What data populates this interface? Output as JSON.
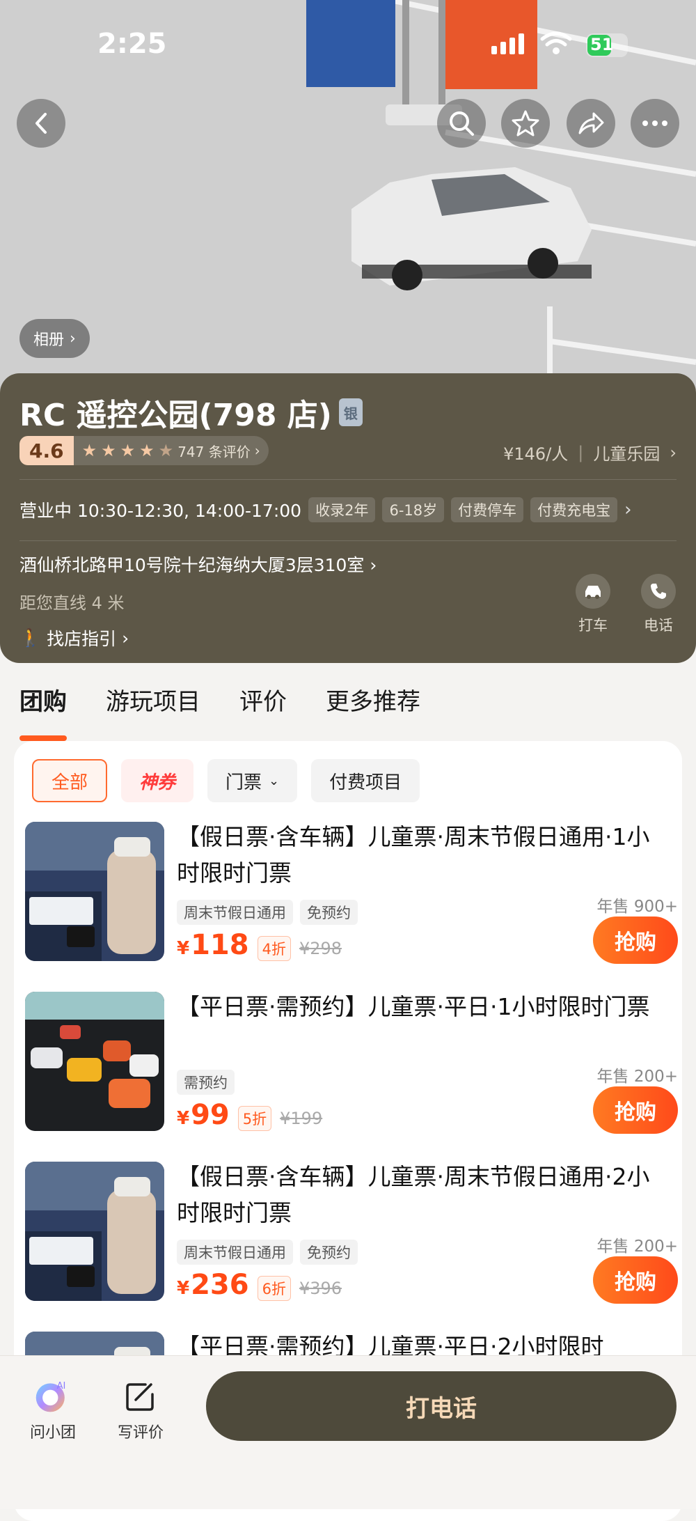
{
  "status": {
    "time": "2:25",
    "battery": "51"
  },
  "hero": {
    "album_label": "相册"
  },
  "shop": {
    "name": "RC 遥控公园(798 店)",
    "level_badge": "银",
    "score": "4.6",
    "star_rating": 4.5,
    "reviews": "747 条评价",
    "price_per_person": "¥146/人",
    "category": "儿童乐园",
    "hours": "营业中 10:30-12:30, 14:00-17:00",
    "tags": [
      "收录2年",
      "6-18岁",
      "付费停车",
      "付费充电宝"
    ],
    "address": "酒仙桥北路甲10号院十纪海纳大厦3层310室",
    "distance": "距您直线 4 米",
    "guide": "找店指引",
    "taxi_label": "打车",
    "phone_label": "电话"
  },
  "tabs": [
    "团购",
    "游玩项目",
    "评价",
    "更多推荐"
  ],
  "filters": [
    "全部",
    "神券",
    "门票",
    "付费项目"
  ],
  "deals": [
    {
      "title": "【假日票·含车辆】儿童票·周末节假日通用·1小时限时门票",
      "tags": [
        "周末节假日通用",
        "免预约"
      ],
      "yen": "¥",
      "price": "118",
      "discount": "4折",
      "original": "¥298",
      "sold": "年售 900+",
      "buy": "抢购"
    },
    {
      "title": "【平日票·需预约】儿童票·平日·1小时限时门票",
      "tags": [
        "需预约"
      ],
      "yen": "¥",
      "price": "99",
      "discount": "5折",
      "original": "¥199",
      "sold": "年售 200+",
      "buy": "抢购"
    },
    {
      "title": "【假日票·含车辆】儿童票·周末节假日通用·2小时限时门票",
      "tags": [
        "周末节假日通用",
        "免预约"
      ],
      "yen": "¥",
      "price": "236",
      "discount": "6折",
      "original": "¥396",
      "sold": "年售 200+",
      "buy": "抢购"
    },
    {
      "title": "【平日票·需预约】儿童票·平日·2小时限时"
    }
  ],
  "bottom": {
    "ask": "问小团",
    "review": "写评价",
    "call": "打电话",
    "ai": "AI"
  }
}
